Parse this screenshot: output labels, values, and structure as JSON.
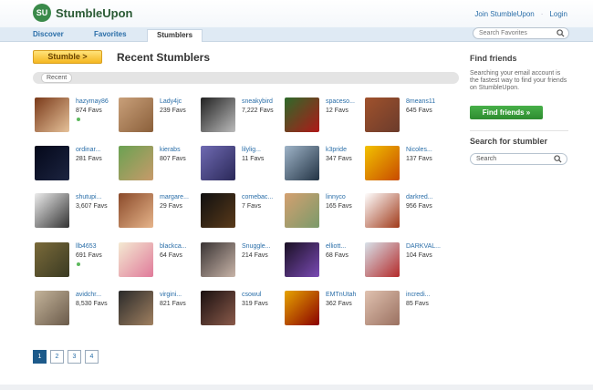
{
  "brand": {
    "name": "StumbleUpon",
    "mark": "SU"
  },
  "header": {
    "join": "Join StumbleUpon",
    "separator": "·",
    "login": "Login"
  },
  "tabs": [
    {
      "label": "Discover"
    },
    {
      "label": "Favorites"
    },
    {
      "label": "Stumblers"
    }
  ],
  "search_favorites": {
    "placeholder": "Search Favorites"
  },
  "main": {
    "stumble_button": "Stumble >",
    "title": "Recent Stumblers",
    "filter": "Recent"
  },
  "users": [
    {
      "name": "hazymay86",
      "favs": "874 Favs",
      "online": true,
      "colors": [
        "#7a3a1a",
        "#e6c29a"
      ]
    },
    {
      "name": "Lady4jc",
      "favs": "239 Favs",
      "online": false,
      "colors": [
        "#c9a07a",
        "#8a5f3a"
      ]
    },
    {
      "name": "sneakybird",
      "favs": "7,222 Favs",
      "online": false,
      "colors": [
        "#222222",
        "#bbbbbb"
      ]
    },
    {
      "name": "spaceso...",
      "favs": "12 Favs",
      "online": false,
      "colors": [
        "#2d6a2a",
        "#b01818"
      ]
    },
    {
      "name": "8means11",
      "favs": "645 Favs",
      "online": false,
      "colors": [
        "#a0522d",
        "#6b3b2b"
      ]
    },
    {
      "name": "ordinar...",
      "favs": "281 Favs",
      "online": false,
      "colors": [
        "#04081a",
        "#1c2440"
      ]
    },
    {
      "name": "kierabs",
      "favs": "807 Favs",
      "online": false,
      "colors": [
        "#6aa252",
        "#c89a6a"
      ]
    },
    {
      "name": "lilylig...",
      "favs": "11 Favs",
      "online": false,
      "colors": [
        "#6f6ab2",
        "#2a2858"
      ]
    },
    {
      "name": "k3pride",
      "favs": "347 Favs",
      "online": false,
      "colors": [
        "#9fb4c8",
        "#223344"
      ]
    },
    {
      "name": "Nicoles...",
      "favs": "137 Favs",
      "online": false,
      "colors": [
        "#f2c200",
        "#c84a00"
      ]
    },
    {
      "name": "shutupi...",
      "favs": "3,607 Favs",
      "online": false,
      "colors": [
        "#ececec",
        "#333333"
      ]
    },
    {
      "name": "margare...",
      "favs": "29 Favs",
      "online": false,
      "colors": [
        "#8a4a2a",
        "#e6b48a"
      ]
    },
    {
      "name": "comebac...",
      "favs": "7 Favs",
      "online": false,
      "colors": [
        "#101010",
        "#5a3a1a"
      ]
    },
    {
      "name": "linnyco",
      "favs": "165 Favs",
      "online": false,
      "colors": [
        "#d4a070",
        "#7a9a6a"
      ]
    },
    {
      "name": "darkred...",
      "favs": "956 Favs",
      "online": false,
      "colors": [
        "#ffffff",
        "#a03a1a"
      ]
    },
    {
      "name": "llb4653",
      "favs": "691 Favs",
      "online": true,
      "colors": [
        "#7a6a3a",
        "#3a3a22"
      ]
    },
    {
      "name": "blackca...",
      "favs": "64 Favs",
      "online": false,
      "colors": [
        "#f4ead2",
        "#e07a9a"
      ]
    },
    {
      "name": "Snuggle...",
      "favs": "214 Favs",
      "online": false,
      "colors": [
        "#3a3434",
        "#c8b4a8"
      ]
    },
    {
      "name": "elliott...",
      "favs": "68 Favs",
      "online": false,
      "colors": [
        "#1a1024",
        "#7a4ab4"
      ]
    },
    {
      "name": "DARKVAL...",
      "favs": "104 Favs",
      "online": false,
      "colors": [
        "#d8e2ea",
        "#b42a2a"
      ]
    },
    {
      "name": "avidchr...",
      "favs": "8,530 Favs",
      "online": false,
      "colors": [
        "#c4b49a",
        "#6a5a4a"
      ]
    },
    {
      "name": "virgini...",
      "favs": "821 Favs",
      "online": false,
      "colors": [
        "#2a2a2a",
        "#a08060"
      ]
    },
    {
      "name": "csowul",
      "favs": "319 Favs",
      "online": false,
      "colors": [
        "#1a1010",
        "#8a5a4a"
      ]
    },
    {
      "name": "EMTnUtah",
      "favs": "362 Favs",
      "online": false,
      "colors": [
        "#e6a400",
        "#8a0000"
      ]
    },
    {
      "name": "incredi...",
      "favs": "85 Favs",
      "online": false,
      "colors": [
        "#e0c2b0",
        "#9a7060"
      ]
    }
  ],
  "pagination": [
    "1",
    "2",
    "3",
    "4"
  ],
  "sidebar": {
    "find_title": "Find friends",
    "find_text": "Searching your email account is the fastest way to find your friends on StumbleUpon.",
    "find_button": "Find friends »",
    "search_title": "Search for stumbler",
    "search_placeholder": "Search"
  }
}
